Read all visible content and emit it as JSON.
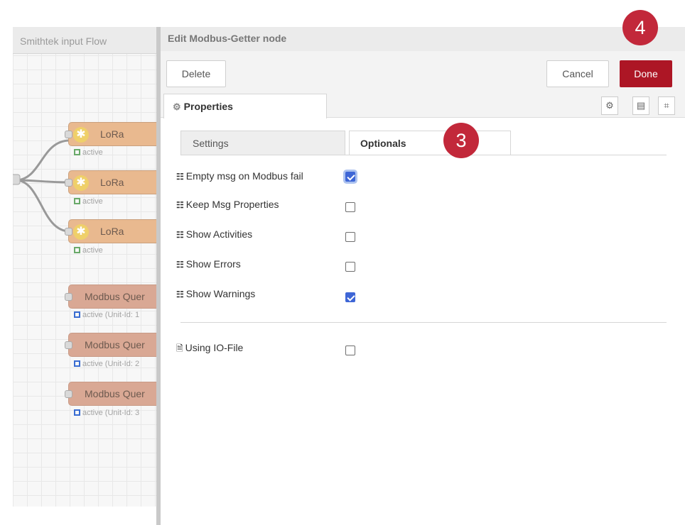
{
  "workspace": {
    "tab_label": "Smithtek input Flow",
    "nodes": [
      {
        "label": "LoRa",
        "status": "active"
      },
      {
        "label": "LoRa",
        "status": "active"
      },
      {
        "label": "LoRa",
        "status": "active"
      },
      {
        "label": "Modbus Quer",
        "status": "active (Unit-Id: 1"
      },
      {
        "label": "Modbus Quer",
        "status": "active (Unit-Id: 2"
      },
      {
        "label": "Modbus Quer",
        "status": "active (Unit-Id: 3"
      }
    ]
  },
  "panel": {
    "title": "Edit Modbus-Getter node",
    "delete_label": "Delete",
    "cancel_label": "Cancel",
    "done_label": "Done",
    "properties_tab": "Properties",
    "tabs": {
      "settings": "Settings",
      "optionals": "Optionals"
    },
    "options": [
      {
        "label": "Empty msg on Modbus fail",
        "checked": true
      },
      {
        "label": "Keep Msg Properties",
        "checked": false
      },
      {
        "label": "Show Activities",
        "checked": false
      },
      {
        "label": "Show Errors",
        "checked": false
      },
      {
        "label": "Show Warnings",
        "checked": true
      }
    ],
    "io_file": {
      "label": "Using IO-File",
      "checked": false
    }
  },
  "badges": {
    "step3": "3",
    "step4": "4"
  },
  "colors": {
    "done": "#ad1625",
    "badge": "#c2283a",
    "checkbox": "#3e66d6",
    "lora_node": "#e9b98f",
    "modbus_node": "#d9a894"
  }
}
